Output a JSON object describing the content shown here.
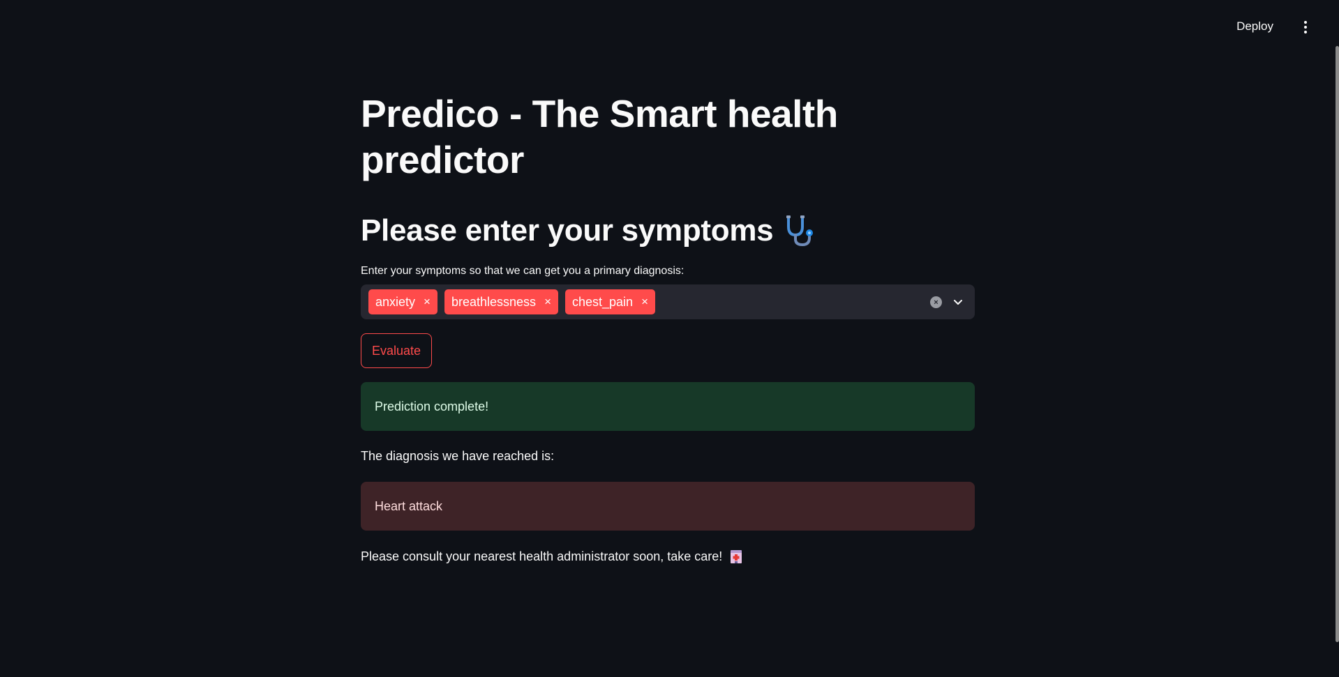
{
  "header": {
    "deploy_label": "Deploy"
  },
  "page": {
    "title": "Predico - The Smart health predictor",
    "subheader": "Please enter your symptoms",
    "symptoms_label": "Enter your symptoms so that we can get you a primary diagnosis:",
    "selected_symptoms": [
      "anxiety",
      "breathlessness",
      "chest_pain"
    ],
    "evaluate_label": "Evaluate",
    "success_message": "Prediction complete!",
    "diagnosis_label": "The diagnosis we have reached is:",
    "diagnosis_value": "Heart attack",
    "consult_message": "Please consult your nearest health administrator soon, take care!"
  },
  "icons": {
    "subheader_icon": "stethoscope-icon",
    "consult_icon": "hospital-icon",
    "tag_remove": "×",
    "clear_all": "×"
  },
  "colors": {
    "background": "#0e1117",
    "accent": "#ff4b4b",
    "success_bg": "#173928",
    "error_bg": "#3e2327",
    "input_bg": "#262730"
  }
}
